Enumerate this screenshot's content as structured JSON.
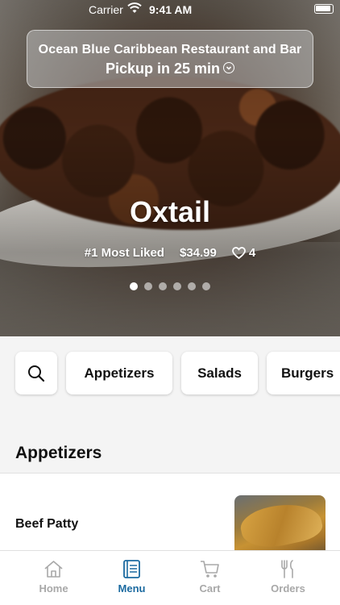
{
  "status_bar": {
    "carrier": "Carrier",
    "time": "9:41 AM"
  },
  "restaurant": {
    "name": "Ocean Blue Caribbean Restaurant and Bar",
    "pickup": "Pickup in 25 min"
  },
  "featured": {
    "title": "Oxtail",
    "rank": "#1 Most Liked",
    "price": "$34.99",
    "likes": "4",
    "slide_count": 6,
    "active_slide": 1
  },
  "categories": [
    "Appetizers",
    "Salads",
    "Burgers"
  ],
  "menu": {
    "section_title": "Appetizers",
    "items": [
      {
        "name": "Beef Patty"
      }
    ]
  },
  "tabs": [
    {
      "label": "Home",
      "icon": "home-icon",
      "active": false
    },
    {
      "label": "Menu",
      "icon": "menu-icon",
      "active": true
    },
    {
      "label": "Cart",
      "icon": "cart-icon",
      "active": false
    },
    {
      "label": "Orders",
      "icon": "orders-icon",
      "active": false
    }
  ],
  "colors": {
    "accent": "#1b6aa0",
    "inactive": "#a8a8a8"
  }
}
